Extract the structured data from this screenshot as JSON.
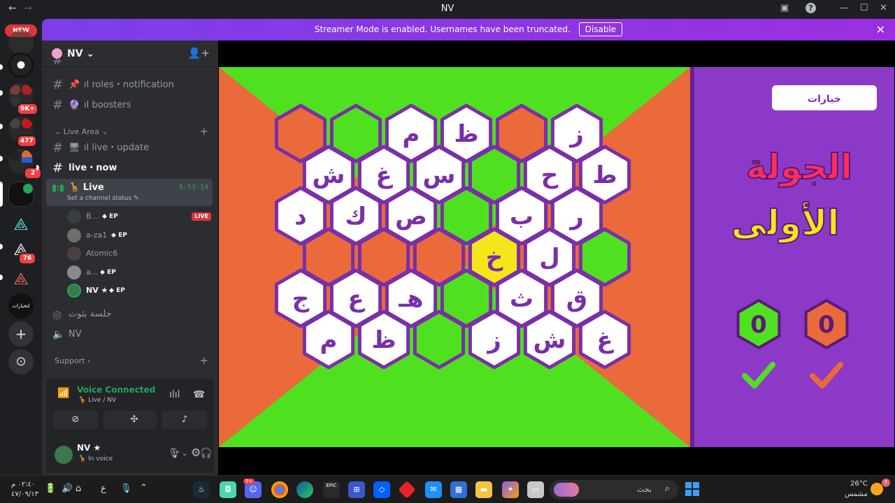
{
  "titlebar": {
    "title": "NV",
    "back": "←",
    "forward": "→",
    "min": "—",
    "max": "☐",
    "close": "✕",
    "help": "?"
  },
  "rail": {
    "new_label": "NEW",
    "badges": [
      "9K+",
      "477",
      "2",
      "76"
    ],
    "text_server": "لتخيارات",
    "add": "+",
    "discover": "⊙"
  },
  "banner": {
    "message": "Streamer Mode is enabled. Usernames have been truncated.",
    "disable_label": "Disable",
    "close": "✕"
  },
  "sidebar": {
    "server_name": "NV",
    "channels_top": [
      {
        "label": "𝗿oles・notification",
        "text": "ıl roles・notification"
      },
      {
        "label": "boosters",
        "text": "ıl boosters"
      }
    ],
    "cat_live": "Live Area",
    "live_update": "ıl live・update",
    "live_now": "live・now",
    "voice_channel": {
      "name": "Live",
      "status": "Set a channel status",
      "timer": "5:53:14"
    },
    "voice_users": [
      {
        "name": "B...",
        "ep": "EP",
        "live": "LIVE"
      },
      {
        "name": "a-za1",
        "ep": "EP"
      },
      {
        "name": "Atomic6"
      },
      {
        "name": "a...",
        "ep": "EP"
      },
      {
        "name": "NV ★",
        "ep": "EP"
      }
    ],
    "session_channel": "جلسة بثوث",
    "nv_channel": "NV",
    "cat_support": "Support"
  },
  "voice_panel": {
    "title": "Voice Connected",
    "sub": "Live / NV",
    "user_name": "NV ★",
    "user_status": "In voice"
  },
  "game": {
    "colors": {
      "orange": "#ea6a3b",
      "green": "#4fe11f",
      "purple": "#7a2fa8",
      "white": "#ffffff",
      "yellow": "#f4e61a",
      "panel": "#8d39c8"
    },
    "options_label": "خيارات",
    "round_line1": "الجولة",
    "round_line2": "الأولى",
    "score_green": "0",
    "score_orange": "0",
    "rows": [
      [
        "O",
        "G",
        "م",
        "ظ",
        "O",
        "ز"
      ],
      [
        "ش",
        "غ",
        "س",
        "G",
        "ح",
        "ط"
      ],
      [
        "د",
        "ك",
        "ص",
        "G",
        "ب",
        "ر"
      ],
      [
        "O",
        "O",
        "O",
        "Y:خ",
        "ل",
        "G"
      ],
      [
        "ج",
        "ع",
        "هـ",
        "G",
        "ث",
        "ق"
      ],
      [
        "م",
        "ظ",
        "G",
        "ز",
        "ش",
        "غ"
      ]
    ]
  },
  "taskbar": {
    "time": "٠٢:٤٠ م",
    "date": "٤٧/٠٩/١٣",
    "lang": "ع",
    "search_placeholder": "بحث",
    "temp": "26°C",
    "weather": "مشمس",
    "discord_badge": "9+"
  }
}
